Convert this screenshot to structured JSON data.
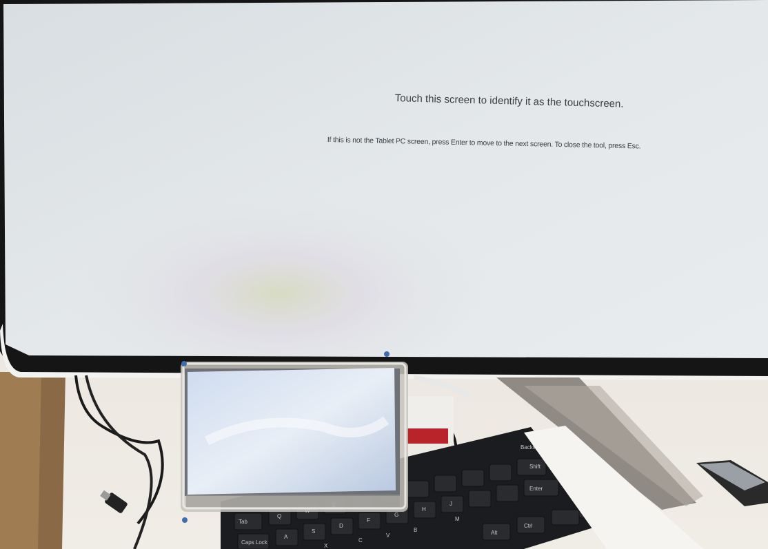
{
  "monitor_screen": {
    "prompt_main": "Touch this screen to identify it as the touchscreen.",
    "prompt_sub": "If this is not the Tablet PC screen, press Enter to move to the next screen. To close the tool, press Esc."
  },
  "keyboard": {
    "keys": [
      "Tab",
      "Caps Lock",
      "Q",
      "W",
      "E",
      "A",
      "S",
      "D",
      "F",
      "G",
      "H",
      "J",
      "X",
      "C",
      "V",
      "B",
      "M",
      "Alt",
      "Ctrl",
      "Enter",
      "Shift",
      "Backspace"
    ]
  },
  "colors": {
    "monitor_screen": "#dfe4e6",
    "monitor_bezel": "#1a1a1a",
    "desk": "#ede7df",
    "keyboard": "#1c1d20",
    "small_display": "#c8d6ea"
  }
}
